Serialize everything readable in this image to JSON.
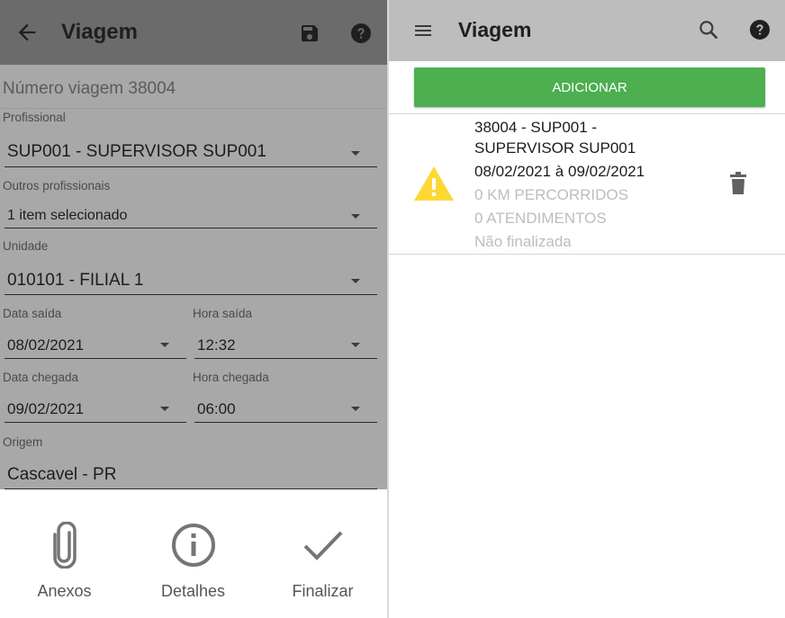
{
  "left_screen": {
    "title": "Viagem",
    "trip_number": "Número viagem 38004",
    "profissional": {
      "label": "Profissional",
      "value": "SUP001 - SUPERVISOR SUP001"
    },
    "outros_profissionais": {
      "label": "Outros profissionais",
      "value": "1 item selecionado"
    },
    "unidade": {
      "label": "Unidade",
      "value": "010101 - FILIAL 1"
    },
    "data_saida": {
      "label": "Data saída",
      "value": "08/02/2021"
    },
    "hora_saida": {
      "label": "Hora saída",
      "value": "12:32"
    },
    "data_chegada": {
      "label": "Data chegada",
      "value": "09/02/2021"
    },
    "hora_chegada": {
      "label": "Hora chegada",
      "value": "06:00"
    },
    "origem": {
      "label": "Origem",
      "value": "Cascavel - PR"
    },
    "actions": [
      {
        "label": "Anexos",
        "icon": "paperclip-icon"
      },
      {
        "label": "Detalhes",
        "icon": "info-icon"
      },
      {
        "label": "Finalizar",
        "icon": "checkmark-icon"
      }
    ]
  },
  "right_screen": {
    "title": "Viagem",
    "add_button": "ADICIONAR",
    "trips": [
      {
        "line1": "38004 - SUP001 -",
        "line2": "SUPERVISOR SUP001",
        "dates": "08/02/2021 à 09/02/2021",
        "km": "0 KM PERCORRIDOS",
        "atendimentos": "0 ATENDIMENTOS",
        "status": "Não finalizada",
        "status_icon": "warning-icon",
        "status_color": "#fdd835"
      }
    ]
  },
  "colors": {
    "left_appbar": "#6b6b6b",
    "form_overlay": "#a8a8a8",
    "right_appbar": "#bdbdbd",
    "add_button": "#4caf50"
  }
}
